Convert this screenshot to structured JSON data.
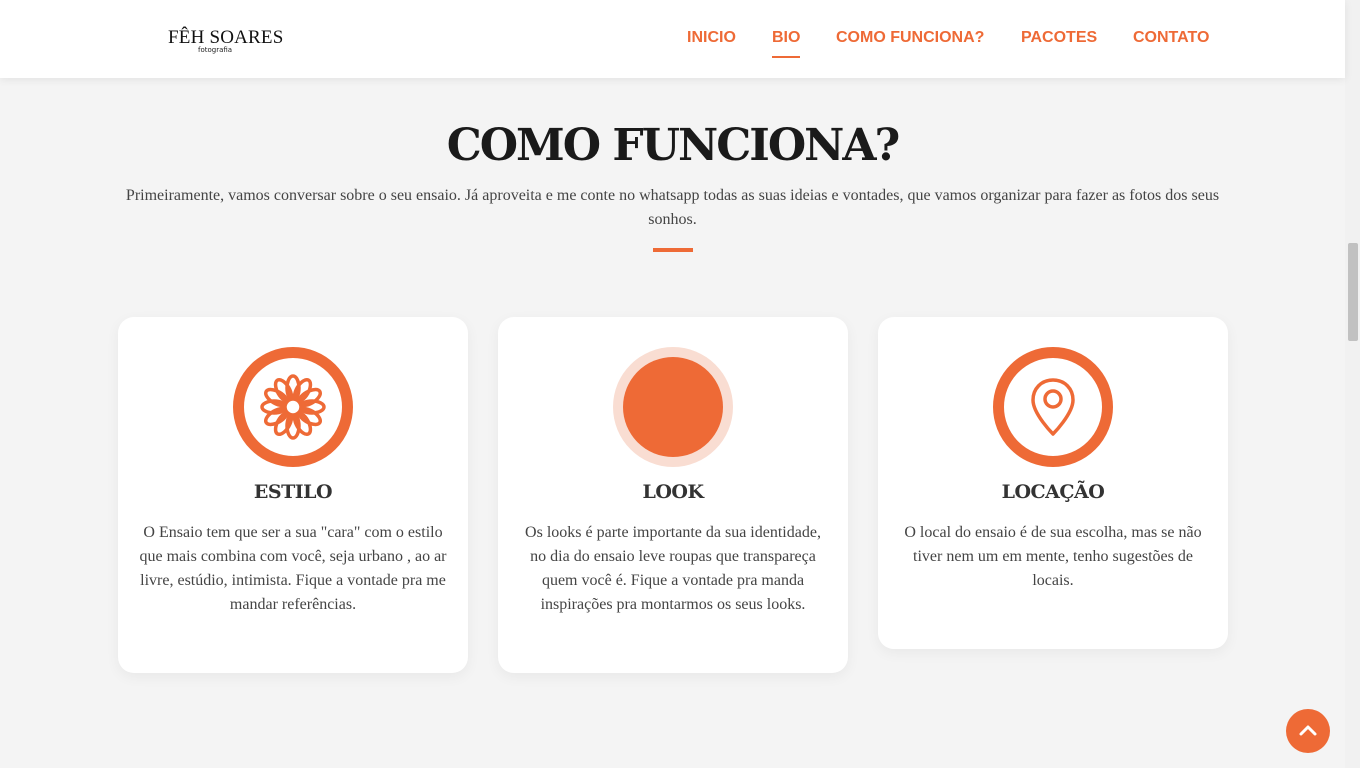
{
  "header": {
    "logo": {
      "main": "FÊH SOARES",
      "sub": "fotografia"
    },
    "nav": [
      {
        "label": "INICIO",
        "active": false
      },
      {
        "label": "BIO",
        "active": true
      },
      {
        "label": "COMO FUNCIONA?",
        "active": false
      },
      {
        "label": "PACOTES",
        "active": false
      },
      {
        "label": "CONTATO",
        "active": false
      }
    ]
  },
  "section": {
    "title": "COMO FUNCIONA?",
    "intro": "Primeiramente, vamos conversar sobre o seu ensaio. Já aproveita e me conte no whatsapp todas as suas ideias e vontades, que vamos organizar para fazer as fotos dos seus sonhos."
  },
  "cards": [
    {
      "icon": "flower-icon",
      "title": "ESTILO",
      "text": "O Ensaio tem que ser a sua \"cara\" com o estilo que mais combina com você, seja urbano , ao ar livre, estúdio, intimista. Fique a vontade pra me mandar referências."
    },
    {
      "icon": "circle-icon",
      "title": "LOOK",
      "text": "Os looks é parte importante da sua identidade, no dia do ensaio leve roupas que transpareça quem você é. Fique a vontade pra manda inspirações pra montarmos os seus looks."
    },
    {
      "icon": "map-pin-icon",
      "title": "LOCAÇÃO",
      "text": "O local do ensaio é de sua escolha, mas se não tiver nem um em mente, tenho sugestões de locais."
    }
  ],
  "colors": {
    "accent": "#ee6a36",
    "accent_light": "#f9ddd2",
    "background": "#f4f4f4"
  }
}
